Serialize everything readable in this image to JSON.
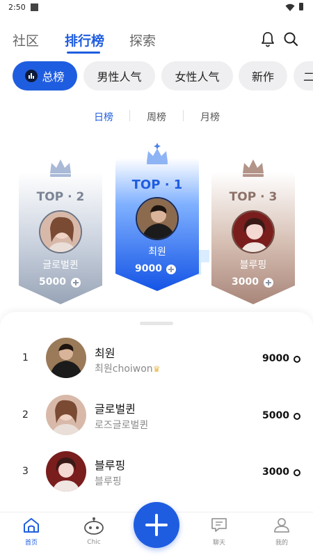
{
  "status_bar": {
    "time": "2:50"
  },
  "header": {
    "tabs": [
      {
        "label": "社区"
      },
      {
        "label": "排行榜"
      },
      {
        "label": "探索"
      }
    ],
    "active_tab": "排行榜"
  },
  "filters": [
    {
      "label": "总榜",
      "active": true
    },
    {
      "label": "男性人气"
    },
    {
      "label": "女性人气"
    },
    {
      "label": "新作"
    },
    {
      "label": "二"
    }
  ],
  "periods": [
    {
      "label": "日榜",
      "active": true
    },
    {
      "label": "周榜"
    },
    {
      "label": "月榜"
    }
  ],
  "podium": {
    "second": {
      "rank": "TOP · 2",
      "name": "글로벌퀸",
      "score": "5000"
    },
    "first": {
      "rank": "TOP · 1",
      "name": "최원",
      "score": "9000"
    },
    "third": {
      "rank": "TOP · 3",
      "name": "블루핑",
      "score": "3000"
    }
  },
  "ranking": [
    {
      "rank": "1",
      "name": "최원",
      "sub": "최원choiwon",
      "score": "9000"
    },
    {
      "rank": "2",
      "name": "글로벌퀸",
      "sub": "로즈글로벌퀸",
      "score": "5000"
    },
    {
      "rank": "3",
      "name": "블루핑",
      "sub": "블루핑",
      "score": "3000"
    }
  ],
  "bottom_nav": [
    {
      "label": "首页",
      "active": true
    },
    {
      "label": "Chic"
    },
    {
      "label": "聊天"
    },
    {
      "label": "我的"
    }
  ],
  "colors": {
    "accent": "#1f5de0"
  }
}
